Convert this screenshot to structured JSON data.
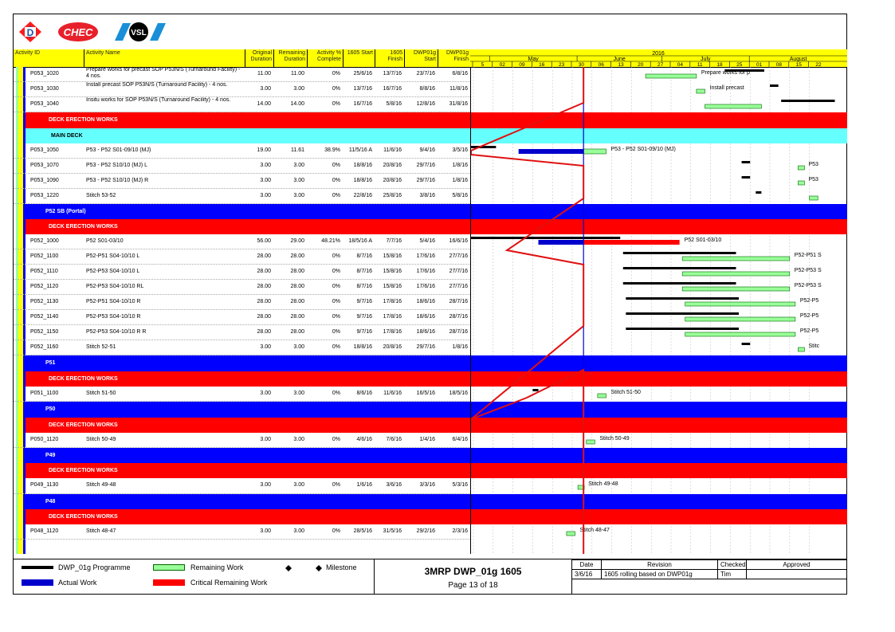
{
  "logos": [
    "D",
    "CHEC",
    "VSL"
  ],
  "columns": {
    "activity_id": "Activity ID",
    "activity_name": "Activity Name",
    "original_duration": "Original Duration",
    "remaining_duration": "Remaining Duration",
    "activity_pct": "Activity % Complete",
    "start_1605": "1605 Start",
    "finish_1605": "1605 Finish",
    "dwp_start": "DWP01g Start",
    "dwp_finish": "DWP01g Finish"
  },
  "timeline": {
    "year": "2016",
    "months": [
      "May",
      "June",
      "July",
      "August"
    ],
    "weeks": [
      "5",
      "02",
      "09",
      "16",
      "23",
      "30",
      "06",
      "13",
      "20",
      "27",
      "04",
      "11",
      "18",
      "25",
      "01",
      "08",
      "15",
      "22"
    ]
  },
  "rows": [
    {
      "type": "task",
      "id": "P053_1020",
      "name": "Prepare works for precast SOP P53N/S (Turnaround Facility) - 4 nos.",
      "od": "11.00",
      "rd": "11.00",
      "pct": "0%",
      "s": "25/6/16",
      "f": "13/7/16",
      "ds": "23/7/16",
      "df": "6/8/16",
      "label": "Prepare works for p"
    },
    {
      "type": "task",
      "id": "P053_1030",
      "name": "Install precast SOP P53N/S (Turnaround Facility) - 4 nos.",
      "od": "3.00",
      "rd": "3.00",
      "pct": "0%",
      "s": "13/7/16",
      "f": "16/7/16",
      "ds": "8/8/16",
      "df": "11/8/16",
      "label": "Install precast"
    },
    {
      "type": "task",
      "id": "P053_1040",
      "name": "Insitu works for SOP P53N/S (Turnaround Facility) - 4 nos.",
      "od": "14.00",
      "rd": "14.00",
      "pct": "0%",
      "s": "16/7/16",
      "f": "5/8/16",
      "ds": "12/8/16",
      "df": "31/8/16",
      "label": ""
    },
    {
      "type": "red",
      "name": "DECK ERECTION WORKS"
    },
    {
      "type": "cyan",
      "name": "MAIN DECK"
    },
    {
      "type": "task",
      "id": "P053_1050",
      "name": "P53 - P52 S01-09/10 (MJ)",
      "od": "19.00",
      "rd": "11.61",
      "pct": "38.9%",
      "s": "11/5/16 A",
      "f": "11/6/16",
      "ds": "9/4/16",
      "df": "3/5/16",
      "label": "P53 - P52 S01-09/10 (MJ)"
    },
    {
      "type": "task",
      "id": "P053_1070",
      "name": "P53 - P52 S10/10 (MJ) L",
      "od": "3.00",
      "rd": "3.00",
      "pct": "0%",
      "s": "18/8/16",
      "f": "20/8/16",
      "ds": "29/7/16",
      "df": "1/8/16",
      "label": "P53"
    },
    {
      "type": "task",
      "id": "P053_1090",
      "name": "P53 - P52 S10/10 (MJ) R",
      "od": "3.00",
      "rd": "3.00",
      "pct": "0%",
      "s": "18/8/16",
      "f": "20/8/16",
      "ds": "29/7/16",
      "df": "1/8/16",
      "label": "P53"
    },
    {
      "type": "task",
      "id": "P053_1220",
      "name": "Stitch 53-52",
      "od": "3.00",
      "rd": "3.00",
      "pct": "0%",
      "s": "22/8/16",
      "f": "25/8/16",
      "ds": "3/8/16",
      "df": "5/8/16",
      "label": ""
    },
    {
      "type": "blue",
      "name": "P52 SB (Portal)"
    },
    {
      "type": "red",
      "name": "DECK ERECTION WORKS"
    },
    {
      "type": "task",
      "id": "P052_1000",
      "name": "P52 S01-03/10",
      "od": "56.00",
      "rd": "29.00",
      "pct": "48.21%",
      "s": "18/5/16 A",
      "f": "7/7/16",
      "ds": "5/4/16",
      "df": "16/6/16",
      "label": "P52 S01-03/10"
    },
    {
      "type": "task",
      "id": "P052_1100",
      "name": "P52-P51 S04-10/10 L",
      "od": "28.00",
      "rd": "28.00",
      "pct": "0%",
      "s": "8/7/16",
      "f": "15/8/16",
      "ds": "17/6/16",
      "df": "27/7/16",
      "label": "P52-P51 S"
    },
    {
      "type": "task",
      "id": "P052_1110",
      "name": "P52-P53 S04-10/10 L",
      "od": "28.00",
      "rd": "28.00",
      "pct": "0%",
      "s": "8/7/16",
      "f": "15/8/16",
      "ds": "17/6/16",
      "df": "27/7/16",
      "label": "P52-P53 S"
    },
    {
      "type": "task",
      "id": "P052_1120",
      "name": "P52-P53 S04-10/10 RL",
      "od": "28.00",
      "rd": "28.00",
      "pct": "0%",
      "s": "8/7/16",
      "f": "15/8/16",
      "ds": "17/6/16",
      "df": "27/7/16",
      "label": "P52-P53 S"
    },
    {
      "type": "task",
      "id": "P052_1130",
      "name": "P52-P51 S04-10/10 R",
      "od": "28.00",
      "rd": "28.00",
      "pct": "0%",
      "s": "9/7/16",
      "f": "17/8/16",
      "ds": "18/6/16",
      "df": "28/7/16",
      "label": "P52-P5"
    },
    {
      "type": "task",
      "id": "P052_1140",
      "name": "P52-P53 S04-10/10 R",
      "od": "28.00",
      "rd": "28.00",
      "pct": "0%",
      "s": "9/7/16",
      "f": "17/8/16",
      "ds": "18/6/16",
      "df": "28/7/16",
      "label": "P52-P5"
    },
    {
      "type": "task",
      "id": "P052_1150",
      "name": "P52-P53 S04-10/10 R R",
      "od": "28.00",
      "rd": "28.00",
      "pct": "0%",
      "s": "9/7/16",
      "f": "17/8/16",
      "ds": "18/6/16",
      "df": "28/7/16",
      "label": "P52-P5"
    },
    {
      "type": "task",
      "id": "P052_1160",
      "name": "Stitch 52-51",
      "od": "3.00",
      "rd": "3.00",
      "pct": "0%",
      "s": "18/8/16",
      "f": "20/8/16",
      "ds": "29/7/16",
      "df": "1/8/16",
      "label": "Stitc"
    },
    {
      "type": "blue",
      "name": "P51"
    },
    {
      "type": "red",
      "name": "DECK ERECTION WORKS"
    },
    {
      "type": "task",
      "id": "P051_1100",
      "name": "Stitch 51-50",
      "od": "3.00",
      "rd": "3.00",
      "pct": "0%",
      "s": "8/6/16",
      "f": "11/6/16",
      "ds": "16/5/16",
      "df": "18/5/16",
      "label": "Stitch 51-50"
    },
    {
      "type": "blue",
      "name": "P50"
    },
    {
      "type": "red",
      "name": "DECK ERECTION WORKS"
    },
    {
      "type": "task",
      "id": "P050_1120",
      "name": "Stitch 50-49",
      "od": "3.00",
      "rd": "3.00",
      "pct": "0%",
      "s": "4/6/16",
      "f": "7/6/16",
      "ds": "1/4/16",
      "df": "6/4/16",
      "label": "Stitch 50-49"
    },
    {
      "type": "blue",
      "name": "P49"
    },
    {
      "type": "red",
      "name": "DECK ERECTION WORKS"
    },
    {
      "type": "task",
      "id": "P049_1130",
      "name": "Stitch 49-48",
      "od": "3.00",
      "rd": "3.00",
      "pct": "0%",
      "s": "1/6/16",
      "f": "3/6/16",
      "ds": "3/3/16",
      "df": "5/3/16",
      "label": "Stitch 49-48"
    },
    {
      "type": "blue",
      "name": "P48"
    },
    {
      "type": "red",
      "name": "DECK ERECTION WORKS"
    },
    {
      "type": "task",
      "id": "P048_1120",
      "name": "Stitch 48-47",
      "od": "3.00",
      "rd": "3.00",
      "pct": "0%",
      "s": "28/5/16",
      "f": "31/5/16",
      "ds": "29/2/16",
      "df": "2/3/16",
      "label": "Stitch 48-47"
    }
  ],
  "legend": {
    "programme": "DWP_01g Programme",
    "remaining": "Remaining Work",
    "milestone": "Milestone",
    "actual": "Actual Work",
    "critical": "Critical Remaining Work",
    "colors": {
      "programme": "#000000",
      "remaining": "#99ff99",
      "actual": "#0000cc",
      "critical": "#ff0000"
    }
  },
  "title_block": {
    "title": "3MRP DWP_01g 1605",
    "page": "Page 13 of 18"
  },
  "revision_table": {
    "headers": [
      "Date",
      "Revision",
      "Checked",
      "Approved"
    ],
    "row": [
      "3/6/16",
      "1605 rolling based on DWP01g",
      "Tim",
      ""
    ]
  }
}
